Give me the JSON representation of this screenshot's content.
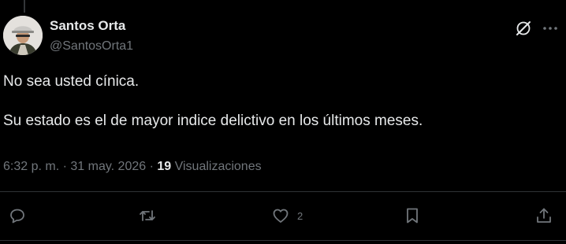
{
  "author": {
    "display_name": "Santos Orta",
    "handle": "@SantosOrta1"
  },
  "post": {
    "paragraphs": [
      "No sea usted cínica.",
      "Su estado es el de mayor indice delictivo en los últimos meses."
    ]
  },
  "meta": {
    "time": "6:32 p. m.",
    "separator": " · ",
    "date": "31 may. 2026",
    "views_count": "19",
    "views_label": "Visualizaciones"
  },
  "actions": {
    "reply_icon": "reply-icon",
    "repost_icon": "repost-icon",
    "like_icon": "heart-icon",
    "like_count": "2",
    "bookmark_icon": "bookmark-icon",
    "share_icon": "share-icon"
  },
  "header_icons": {
    "grok": "grok-icon",
    "more": "more-icon"
  },
  "colors": {
    "background": "#000000",
    "primary_text": "#e7e9ea",
    "secondary_text": "#71767b",
    "divider": "#2f3336"
  }
}
